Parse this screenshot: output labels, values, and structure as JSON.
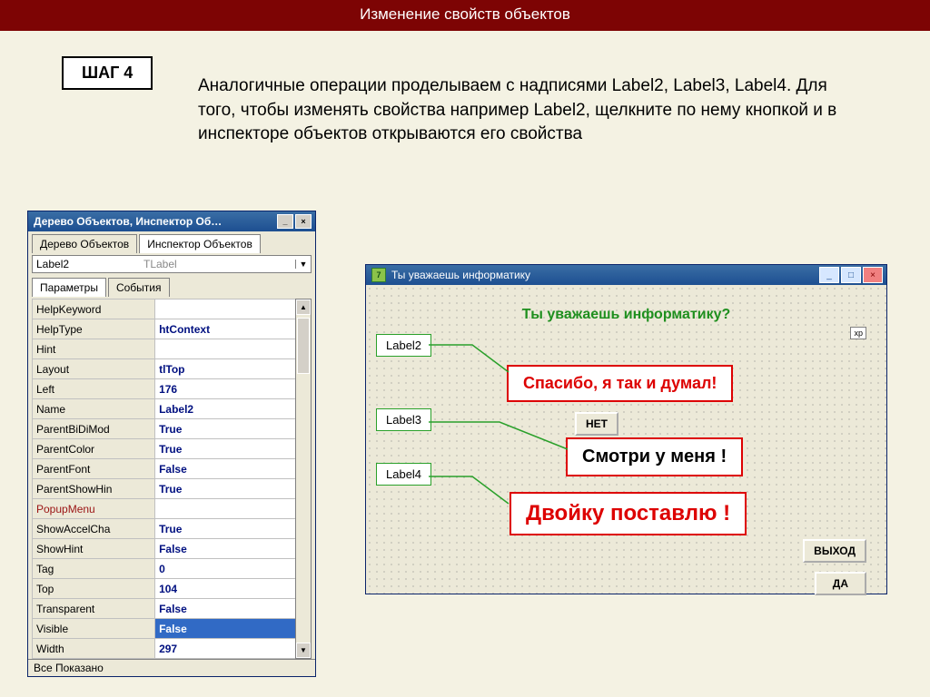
{
  "title": "Изменение свойств объектов",
  "step_label": "ШАГ 4",
  "body": "Аналогичные операции проделываем с надписями Label2, Label3, Label4. Для того, чтобы изменять свойства например Label2, щелкните по нему кнопкой и в инспекторе объектов открываются его свойства",
  "inspector": {
    "window_title": "Дерево Объектов, Инспектор Об…",
    "tabs": {
      "tree": "Дерево Объектов",
      "inspector": "Инспектор Объектов"
    },
    "component": "Label2",
    "component_type": "TLabel",
    "sub_tabs": {
      "params": "Параметры",
      "events": "События"
    },
    "props": [
      {
        "k": "HelpKeyword",
        "v": ""
      },
      {
        "k": "HelpType",
        "v": "htContext"
      },
      {
        "k": "Hint",
        "v": ""
      },
      {
        "k": "Layout",
        "v": "tlTop"
      },
      {
        "k": "Left",
        "v": "176"
      },
      {
        "k": "Name",
        "v": "Label2"
      },
      {
        "k": "ParentBiDiMod",
        "v": "True"
      },
      {
        "k": "ParentColor",
        "v": "True"
      },
      {
        "k": "ParentFont",
        "v": "False"
      },
      {
        "k": "ParentShowHin",
        "v": "True"
      },
      {
        "k": "PopupMenu",
        "v": "",
        "menu": true
      },
      {
        "k": "ShowAccelCha",
        "v": "True"
      },
      {
        "k": "ShowHint",
        "v": "False"
      },
      {
        "k": "Tag",
        "v": "0"
      },
      {
        "k": "Top",
        "v": "104"
      },
      {
        "k": "Transparent",
        "v": "False"
      },
      {
        "k": "Visible",
        "v": "False",
        "sel": true
      },
      {
        "k": "Width",
        "v": "297"
      }
    ],
    "status": "Все Показано"
  },
  "form": {
    "title": "Ты уважаешь информатику",
    "label1": "Ты уважаешь информатику?",
    "label2": "Спасибо, я так и думал!",
    "label3": "Смотри у меня !",
    "label4": "Двойку поставлю !",
    "btn_no": "НЕТ",
    "btn_exit": "ВЫХОД",
    "btn_yes": "ДА",
    "xp": "xp"
  },
  "callouts": {
    "c2": "Label2",
    "c3": "Label3",
    "c4": "Label4"
  }
}
